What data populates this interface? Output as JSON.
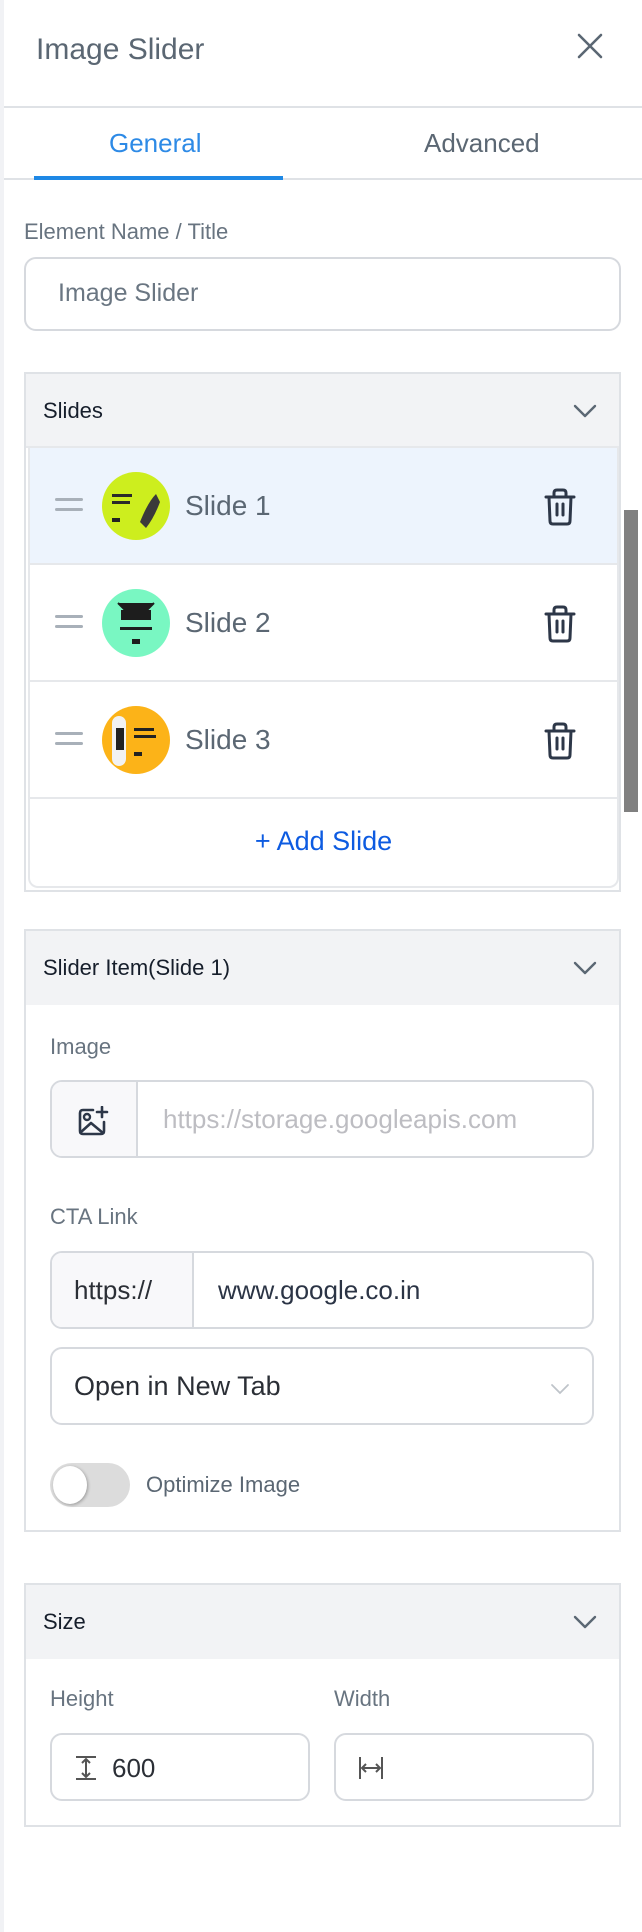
{
  "header": {
    "title": "Image Slider",
    "close_icon": "close-icon"
  },
  "tabs": [
    {
      "label": "General",
      "active": true
    },
    {
      "label": "Advanced",
      "active": false
    }
  ],
  "element_name": {
    "label": "Element Name / Title",
    "value": "Image Slider"
  },
  "slides_panel": {
    "title": "Slides",
    "slides": [
      {
        "label": "Slide 1",
        "thumb_color": "#cdee1e",
        "active": true
      },
      {
        "label": "Slide 2",
        "thumb_color": "#79f7c2",
        "active": false
      },
      {
        "label": "Slide 3",
        "thumb_color": "#fcb318",
        "active": false
      }
    ],
    "add_label": "+ Add Slide"
  },
  "slider_item": {
    "title": "Slider Item(Slide 1)",
    "image_label": "Image",
    "image_url": "https://storage.googleapis.com",
    "cta_label": "CTA Link",
    "cta_prefix": "https://",
    "cta_value": "www.google.co.in",
    "target_select": "Open in New Tab",
    "optimize_label": "Optimize Image",
    "optimize_on": false
  },
  "size_panel": {
    "title": "Size",
    "height_label": "Height",
    "height_value": "600",
    "width_label": "Width",
    "width_value": ""
  },
  "colors": {
    "accent": "#1e88e5",
    "link": "#0d5be1",
    "active_row": "#edf4fd"
  }
}
